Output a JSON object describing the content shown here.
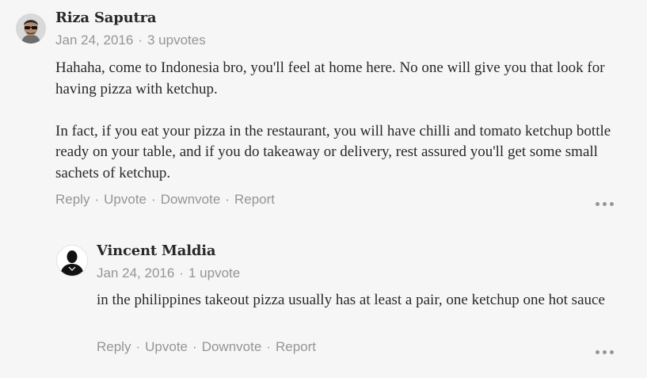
{
  "comments": [
    {
      "author": "Riza Saputra",
      "date": "Jan 24, 2016",
      "upvotes": "3 upvotes",
      "paragraphs": [
        "Hahaha, come to Indonesia bro, you'll feel at home here. No one will give you that look for having pizza with ketchup.",
        "In fact, if you eat your pizza in the restaurant, you will have chilli and tomato ketchup bottle ready on your table, and if you do takeaway or delivery, rest assured you'll get some small sachets of ketchup."
      ],
      "actions": {
        "reply": "Reply",
        "upvote": "Upvote",
        "downvote": "Downvote",
        "report": "Report"
      },
      "avatar_icon": "user-photo-icon"
    },
    {
      "author": "Vincent Maldia",
      "date": "Jan 24, 2016",
      "upvotes": "1 upvote",
      "paragraphs": [
        "in the philippines takeout pizza usually has at least a pair, one ketchup one hot sauce"
      ],
      "actions": {
        "reply": "Reply",
        "upvote": "Upvote",
        "downvote": "Downvote",
        "report": "Report"
      },
      "avatar_icon": "person-silhouette-icon"
    }
  ],
  "separator": "·",
  "more_icon": "more-options-icon",
  "colors": {
    "background": "#f6f6f6",
    "text": "#282829",
    "muted": "#939598"
  }
}
